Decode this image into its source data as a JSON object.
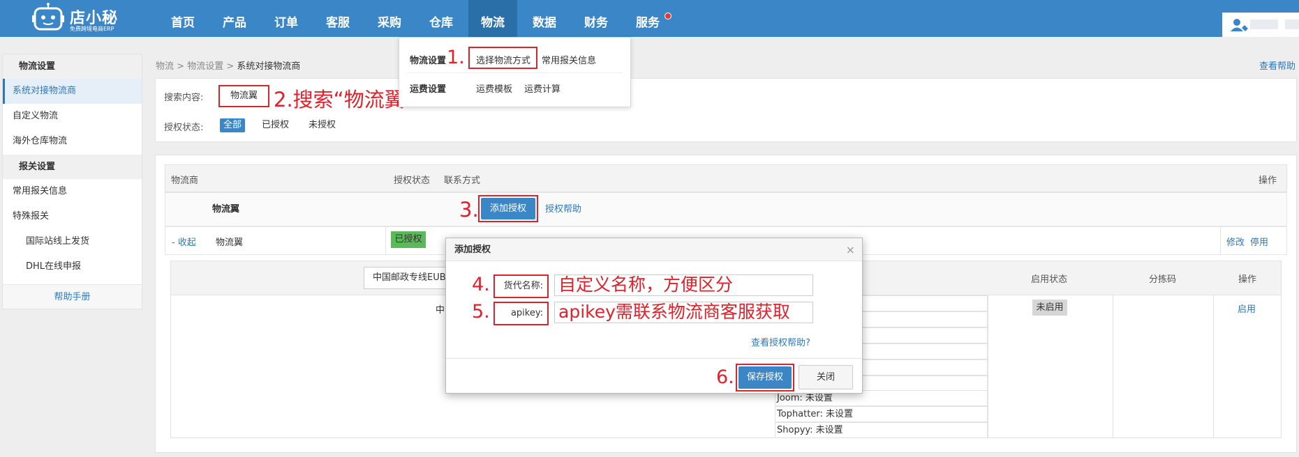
{
  "brand": {
    "title": "店小秘",
    "subtitle": "免费跨境电商ERP"
  },
  "nav": [
    "首页",
    "产品",
    "订单",
    "客服",
    "采购",
    "仓库",
    "物流",
    "数据",
    "财务",
    "服务"
  ],
  "sidebar": {
    "group1": "物流设置",
    "items1": [
      "系统对接物流商",
      "自定义物流",
      "海外仓库物流"
    ],
    "group2": "报关设置",
    "items2": [
      "常用报关信息",
      "特殊报关"
    ],
    "subitems": [
      "国际站线上发货",
      "DHL在线申报"
    ],
    "help": "帮助手册"
  },
  "breadcrumb": {
    "a": "物流",
    "b": "物流设置",
    "c": "系统对接物流商",
    "sep": ">"
  },
  "help_link": "查看帮助",
  "dropdown": {
    "group1": "物流设置",
    "link1": "选择物流方式",
    "link2": "常用报关信息",
    "group2": "运费设置",
    "link3": "运费模板",
    "link4": "运费计算"
  },
  "search": {
    "label": "搜索内容:",
    "value": "物流翼",
    "status_label": "授权状态:",
    "status": [
      "全部",
      "已授权",
      "未授权"
    ]
  },
  "annotations": {
    "n1": "1.",
    "n2": "2.搜索“物流翼”",
    "n3": "3.",
    "n4": "4.",
    "n5": "5.",
    "n6": "6.",
    "hint_name": "自定义名称，方便区分",
    "hint_apikey": "apikey需联系物流商客服获取"
  },
  "table": {
    "headers": [
      "物流商",
      "授权状态",
      "联系方式",
      "操作"
    ],
    "provider": "物流翼",
    "add_auth": "添加授权",
    "auth_help": "授权帮助",
    "collapse": "- 收起",
    "row_name": "物流翼",
    "authorized": "已授权",
    "edit": "修改",
    "disable": "停用"
  },
  "inner": {
    "select": "中国邮政专线EUB",
    "cell_prefix": "中",
    "headers": [
      "启用状态",
      "分拣码",
      "操作"
    ],
    "status": "未启用",
    "enable": "启用",
    "platforms": [
      "Joom: 未设置",
      "Tophatter: 未设置",
      "Shopyy: 未设置"
    ]
  },
  "modal": {
    "title": "添加授权",
    "close": "×",
    "name_label": "货代名称:",
    "apikey_label": "apikey:",
    "help": "查看授权帮助?",
    "save": "保存授权",
    "cancel": "关闭"
  }
}
